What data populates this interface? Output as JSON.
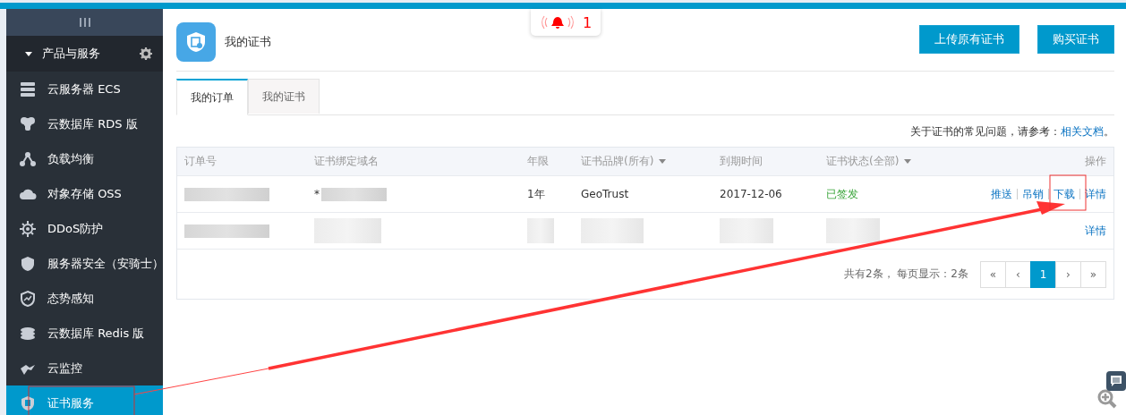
{
  "notice": {
    "count": "1"
  },
  "sidebar": {
    "section": {
      "label": "产品与服务",
      "expanded": true
    },
    "items": [
      {
        "label": "云服务器 ECS",
        "selected": false
      },
      {
        "label": "云数据库 RDS 版",
        "selected": false
      },
      {
        "label": "负载均衡",
        "selected": false
      },
      {
        "label": "对象存储 OSS",
        "selected": false
      },
      {
        "label": "DDoS防护",
        "selected": false
      },
      {
        "label": "服务器安全（安骑士）",
        "selected": false
      },
      {
        "label": "态势感知",
        "selected": false
      },
      {
        "label": "云数据库 Redis 版",
        "selected": false
      },
      {
        "label": "云监控",
        "selected": false
      },
      {
        "label": "证书服务",
        "selected": true
      }
    ]
  },
  "page": {
    "title": "我的证书",
    "buttons": [
      "上传原有证书",
      "购买证书"
    ]
  },
  "tabs": [
    {
      "label": "我的订单",
      "selected": true
    },
    {
      "label": "我的证书",
      "selected": false
    }
  ],
  "help": {
    "text": "关于证书的常见问题，请参考：",
    "link": "相关文档",
    "end": "。"
  },
  "table": {
    "columns": [
      {
        "label": "订单号",
        "filter": false
      },
      {
        "label": "证书绑定域名",
        "filter": false
      },
      {
        "label": "年限",
        "filter": false
      },
      {
        "label": "证书品牌(所有)",
        "filter": true
      },
      {
        "label": "到期时间",
        "filter": false
      },
      {
        "label": "证书状态(全部)",
        "filter": true
      },
      {
        "label": "操作",
        "filter": false
      }
    ],
    "rows": [
      {
        "cells": [
          {
            "kind": "redacted"
          },
          {
            "kind": "partial",
            "text": "*"
          },
          {
            "kind": "text",
            "text": "1年"
          },
          {
            "kind": "text",
            "text": "GeoTrust"
          },
          {
            "kind": "text",
            "text": "2017-12-06"
          },
          {
            "kind": "status",
            "text": "已签发"
          }
        ],
        "actions": [
          "推送",
          "吊销",
          "下载",
          "详情"
        ]
      },
      {
        "cells": [
          {
            "kind": "redacted"
          },
          {
            "kind": "redacted"
          },
          {
            "kind": "redacted"
          },
          {
            "kind": "redacted"
          },
          {
            "kind": "redacted"
          },
          {
            "kind": "redacted"
          }
        ],
        "actions": [
          "详情"
        ]
      }
    ]
  },
  "pagination": {
    "summary": "共有2条， 每页显示：2条",
    "pages": [
      {
        "label": "«",
        "selected": false
      },
      {
        "label": "‹",
        "selected": false
      },
      {
        "label": "1",
        "selected": true
      },
      {
        "label": "›",
        "selected": false
      },
      {
        "label": "»",
        "selected": false
      }
    ]
  }
}
